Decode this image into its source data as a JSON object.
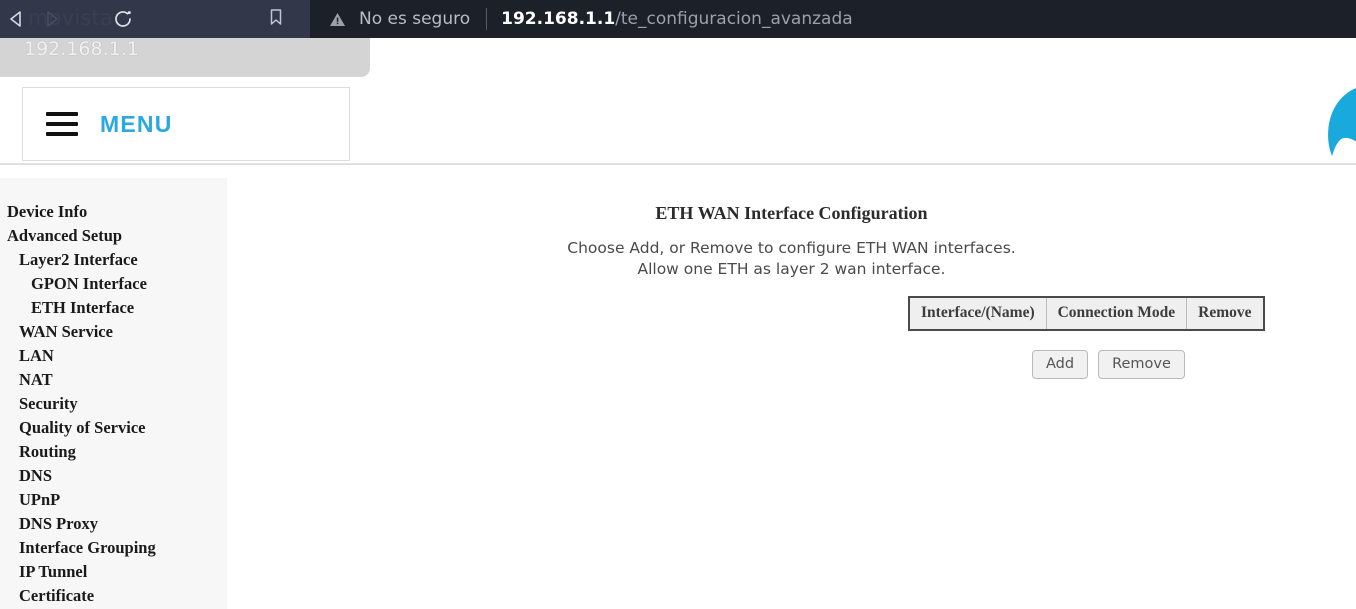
{
  "browser": {
    "back_icon": "back-arrow-icon",
    "forward_icon": "forward-arrow-icon",
    "reload_icon": "reload-icon",
    "bookmark_icon": "bookmark-icon",
    "ghost_brand": "movistar",
    "security_icon": "warning-triangle-icon",
    "security_label": "No es seguro",
    "url_host": "192.168.1.1",
    "url_path": "/te_configuracion_avanzada",
    "tab_label": "192.168.1.1",
    "colors": {
      "chrome_bg": "#32374a",
      "omnibox_bg": "#1c2029",
      "tab_panel_bg": "#d4d4d4"
    }
  },
  "header": {
    "menu_label": "MENU",
    "menu_icon": "hamburger-icon",
    "logo_icon": "movistar-logo-icon",
    "accent_color": "#29a9e0"
  },
  "sidebar": {
    "items": [
      {
        "label": "Device Info",
        "level": 0
      },
      {
        "label": "Advanced Setup",
        "level": 0
      },
      {
        "label": "Layer2 Interface",
        "level": 1
      },
      {
        "label": "GPON Interface",
        "level": 2
      },
      {
        "label": "ETH Interface",
        "level": 2
      },
      {
        "label": "WAN Service",
        "level": 1
      },
      {
        "label": "LAN",
        "level": 1
      },
      {
        "label": "NAT",
        "level": 1
      },
      {
        "label": "Security",
        "level": 1
      },
      {
        "label": "Quality of Service",
        "level": 1
      },
      {
        "label": "Routing",
        "level": 1
      },
      {
        "label": "DNS",
        "level": 1
      },
      {
        "label": "UPnP",
        "level": 1
      },
      {
        "label": "DNS Proxy",
        "level": 1
      },
      {
        "label": "Interface Grouping",
        "level": 1
      },
      {
        "label": "IP Tunnel",
        "level": 1
      },
      {
        "label": "Certificate",
        "level": 1
      }
    ]
  },
  "main": {
    "title": "ETH WAN Interface Configuration",
    "description_line1": "Choose Add, or Remove to configure ETH WAN interfaces.",
    "description_line2": "Allow one ETH as layer 2 wan interface.",
    "table": {
      "columns": [
        "Interface/(Name)",
        "Connection Mode",
        "Remove"
      ],
      "rows": []
    },
    "buttons": {
      "add": "Add",
      "remove": "Remove"
    }
  }
}
